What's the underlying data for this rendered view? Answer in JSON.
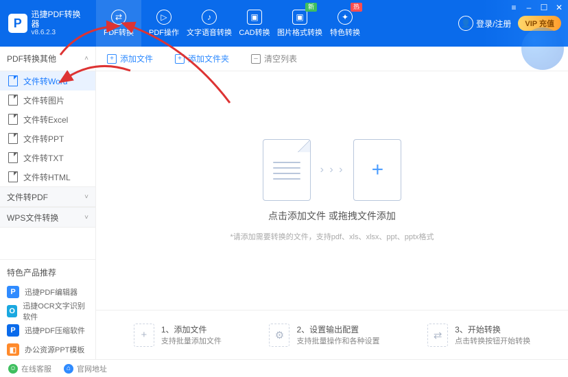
{
  "brand": {
    "title": "迅捷PDF转换器",
    "version": "v8.6.2.3",
    "logo": "P"
  },
  "tabs": [
    {
      "label": "PDF转换",
      "icon": "⇄",
      "active": true
    },
    {
      "label": "PDF操作",
      "icon": "▷"
    },
    {
      "label": "文字语音转换",
      "icon": "♪"
    },
    {
      "label": "CAD转换",
      "icon": "▣"
    },
    {
      "label": "图片格式转换",
      "icon": "▣",
      "badge": "新",
      "badgeClass": "g"
    },
    {
      "label": "特色转换",
      "icon": "✦",
      "badge": "热"
    }
  ],
  "login": "登录/注册",
  "vip": "VIP 充值",
  "winbtns": {
    "menu": "≡",
    "min": "–",
    "max": "☐",
    "close": "✕"
  },
  "sideHead": "PDF转换其他",
  "toolbar": {
    "addFile": "添加文件",
    "addFolder": "添加文件夹",
    "clear": "清空列表"
  },
  "sideItems": [
    {
      "label": "文件转Word",
      "active": true
    },
    {
      "label": "文件转图片"
    },
    {
      "label": "文件转Excel"
    },
    {
      "label": "文件转PPT"
    },
    {
      "label": "文件转TXT"
    },
    {
      "label": "文件转HTML"
    }
  ],
  "groups": [
    "文件转PDF",
    "WPS文件转换"
  ],
  "promoHead": "特色产品推荐",
  "promos": [
    {
      "label": "迅捷PDF编辑器",
      "color": "#2f8bff",
      "glyph": "P"
    },
    {
      "label": "迅捷OCR文字识别软件",
      "color": "#1aa8e0",
      "glyph": "O"
    },
    {
      "label": "迅捷PDF压缩软件",
      "color": "#0a6beb",
      "glyph": "P"
    },
    {
      "label": "办公资源PPT模板",
      "color": "#ff8a2b",
      "glyph": "◧"
    }
  ],
  "drop": {
    "t1": "点击添加文件 或拖拽文件添加",
    "t2": "*请添加需要转换的文件，支持pdf、xls、xlsx、ppt、pptx格式"
  },
  "steps": [
    {
      "num": "1、",
      "title": "添加文件",
      "sub": "支持批量添加文件",
      "icon": "+"
    },
    {
      "num": "2、",
      "title": "设置输出配置",
      "sub": "支持批量操作和各种设置",
      "icon": "⚙"
    },
    {
      "num": "3、",
      "title": "开始转换",
      "sub": "点击转换按钮开始转换",
      "icon": "⇄"
    }
  ],
  "footer": {
    "service": "在线客服",
    "site": "官网地址"
  }
}
